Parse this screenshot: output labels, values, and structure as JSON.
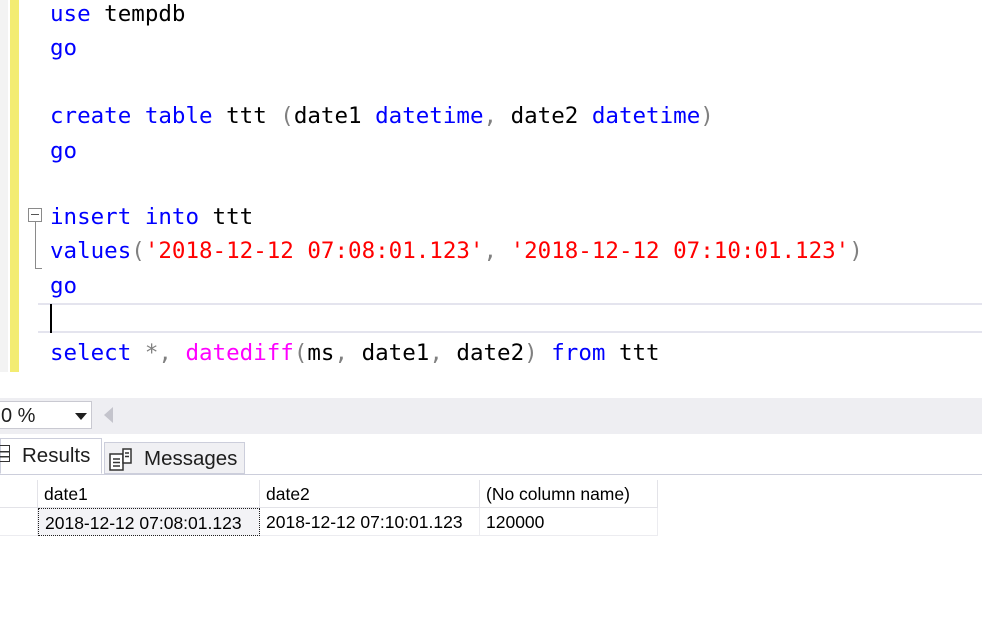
{
  "editor": {
    "lines": [
      {
        "tokens": [
          {
            "t": "use",
            "c": "kw"
          },
          {
            "t": " tempdb",
            "c": "plain"
          }
        ]
      },
      {
        "tokens": [
          {
            "t": "go",
            "c": "kw"
          }
        ]
      },
      {
        "tokens": [
          {
            "t": "create",
            "c": "kw"
          },
          {
            "t": " ",
            "c": "plain"
          },
          {
            "t": "table",
            "c": "kw"
          },
          {
            "t": " ttt ",
            "c": "plain"
          },
          {
            "t": "(",
            "c": "op"
          },
          {
            "t": "date1 ",
            "c": "plain"
          },
          {
            "t": "datetime",
            "c": "kw"
          },
          {
            "t": ",",
            "c": "op"
          },
          {
            "t": " date2 ",
            "c": "plain"
          },
          {
            "t": "datetime",
            "c": "kw"
          },
          {
            "t": ")",
            "c": "op"
          }
        ]
      },
      {
        "tokens": [
          {
            "t": "go",
            "c": "kw"
          }
        ]
      },
      {
        "tokens": [
          {
            "t": "insert",
            "c": "kw"
          },
          {
            "t": " ",
            "c": "plain"
          },
          {
            "t": "into",
            "c": "kw"
          },
          {
            "t": " ttt",
            "c": "plain"
          }
        ]
      },
      {
        "tokens": [
          {
            "t": "values",
            "c": "kw"
          },
          {
            "t": "(",
            "c": "op"
          },
          {
            "t": "'2018-12-12 07:08:01.123'",
            "c": "str"
          },
          {
            "t": ",",
            "c": "op"
          },
          {
            "t": " ",
            "c": "plain"
          },
          {
            "t": "'2018-12-12 07:10:01.123'",
            "c": "str"
          },
          {
            "t": ")",
            "c": "op"
          }
        ]
      },
      {
        "tokens": [
          {
            "t": "go",
            "c": "kw"
          }
        ]
      },
      {
        "tokens": [
          {
            "t": "select",
            "c": "kw"
          },
          {
            "t": " ",
            "c": "plain"
          },
          {
            "t": "*,",
            "c": "op"
          },
          {
            "t": " ",
            "c": "plain"
          },
          {
            "t": "datediff",
            "c": "fn"
          },
          {
            "t": "(",
            "c": "op"
          },
          {
            "t": "ms",
            "c": "plain"
          },
          {
            "t": ",",
            "c": "op"
          },
          {
            "t": " date1",
            "c": "plain"
          },
          {
            "t": ",",
            "c": "op"
          },
          {
            "t": " date2",
            "c": "plain"
          },
          {
            "t": ")",
            "c": "op"
          },
          {
            "t": " ",
            "c": "plain"
          },
          {
            "t": "from",
            "c": "kw"
          },
          {
            "t": " ttt",
            "c": "plain"
          }
        ]
      }
    ]
  },
  "zoom": {
    "value": "0 %"
  },
  "tabs": {
    "results_label": "Results",
    "messages_label": "Messages"
  },
  "grid": {
    "columns": [
      "date1",
      "date2",
      "(No column name)"
    ],
    "rows": [
      [
        "2018-12-12 07:08:01.123",
        "2018-12-12 07:10:01.123",
        "120000"
      ]
    ]
  },
  "colors": {
    "keyword": "#0000ff",
    "function": "#ff00ff",
    "string": "#ff0000",
    "operator": "#808080",
    "change_marker": "#f3ec72"
  }
}
